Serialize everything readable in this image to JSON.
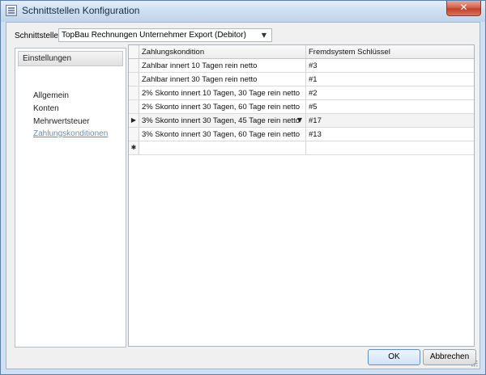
{
  "window": {
    "title": "Schnittstellen Konfiguration",
    "close_glyph": "✕"
  },
  "interface": {
    "label": "Schnittstelle",
    "selected": "TopBau Rechnungen Unternehmer Export (Debitor)"
  },
  "sidebar": {
    "header": "Einstellungen",
    "items": [
      {
        "label": "Allgemein"
      },
      {
        "label": "Konten"
      },
      {
        "label": "Mehrwertsteuer"
      },
      {
        "label": "Zahlungskonditionen"
      }
    ],
    "active_index": 3
  },
  "grid": {
    "columns": [
      "Zahlungskondition",
      "Fremdsystem Schlüssel"
    ],
    "rows": [
      {
        "condition": "Zahlbar innert 10 Tagen rein netto",
        "key": "#3"
      },
      {
        "condition": "Zahlbar innert 30 Tagen rein netto",
        "key": "#1"
      },
      {
        "condition": "2% Skonto innert 10 Tagen, 30 Tage rein netto",
        "key": "#2"
      },
      {
        "condition": "2% Skonto innert 30 Tagen, 60 Tage rein netto",
        "key": "#5"
      },
      {
        "condition": "3% Skonto innert 30 Tagen, 45 Tage rein netto",
        "key": "#17"
      },
      {
        "condition": "3% Skonto innert 30 Tagen, 60 Tage rein netto",
        "key": "#13"
      }
    ],
    "current_row_index": 4,
    "current_marker": "▶",
    "new_row_marker": "✱"
  },
  "buttons": {
    "ok": "OK",
    "cancel": "Abbrechen"
  }
}
